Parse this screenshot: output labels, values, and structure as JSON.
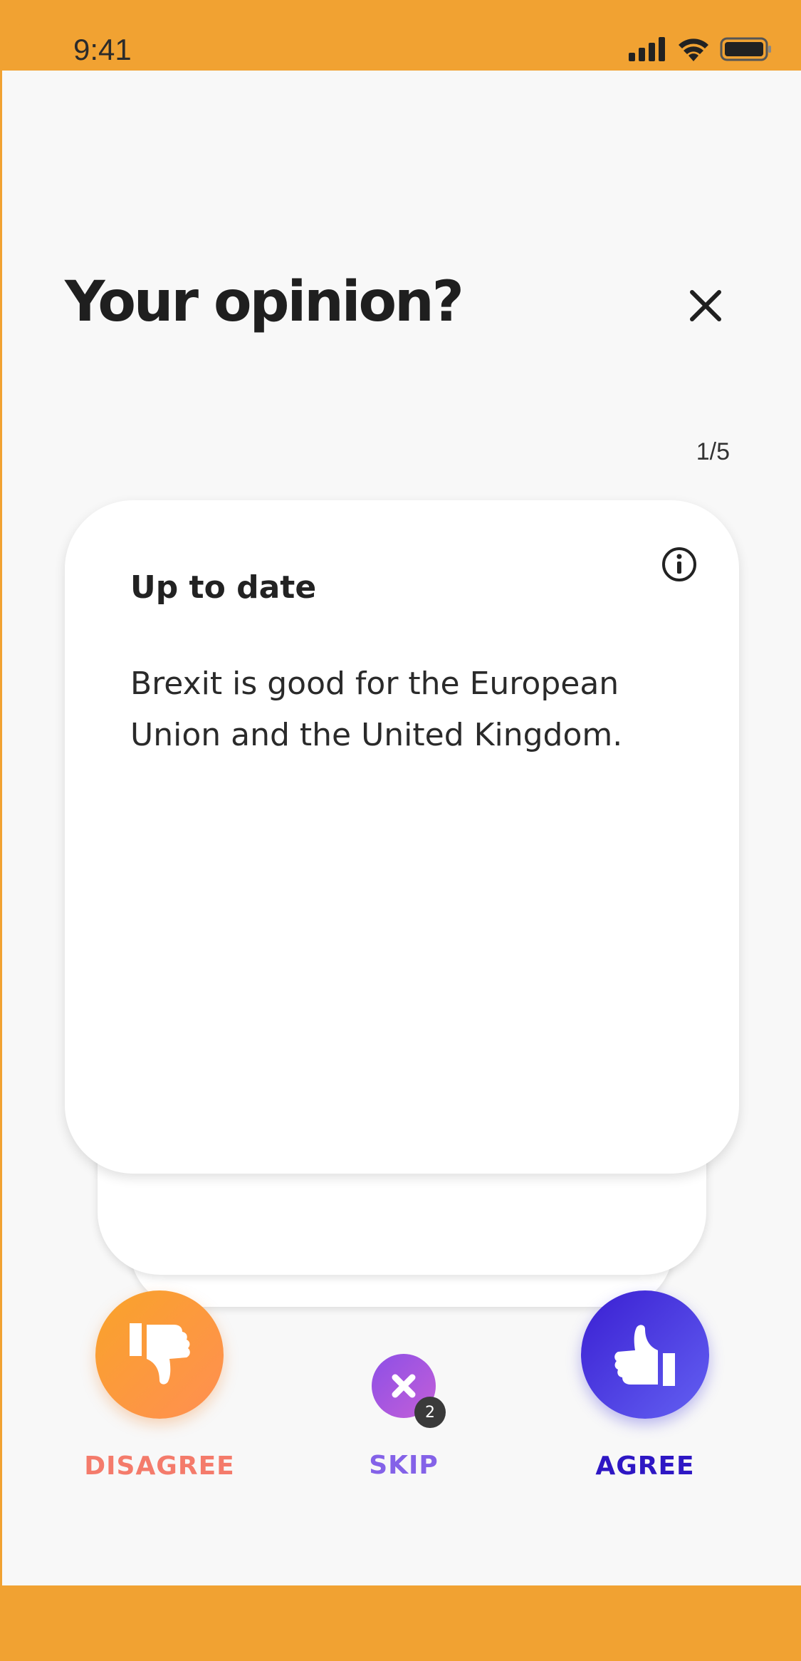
{
  "status_bar": {
    "time": "9:41"
  },
  "header": {
    "title": "Your opinion?",
    "close_icon": "close-icon"
  },
  "progress": {
    "counter": "1/5"
  },
  "card": {
    "category": "Up to date",
    "statement": "Brexit is good for the European Union and the United Kingdom.",
    "info_icon": "info-icon"
  },
  "actions": {
    "disagree": {
      "label": "DISAGREE",
      "icon": "thumbs-down-icon"
    },
    "skip": {
      "label": "SKIP",
      "icon": "close-icon",
      "badge": "2"
    },
    "agree": {
      "label": "AGREE",
      "icon": "thumbs-up-icon"
    }
  },
  "colors": {
    "frame": "#f1a232",
    "disagree": "#f47b6b",
    "skip": "#8462e8",
    "agree": "#2e17c4"
  }
}
